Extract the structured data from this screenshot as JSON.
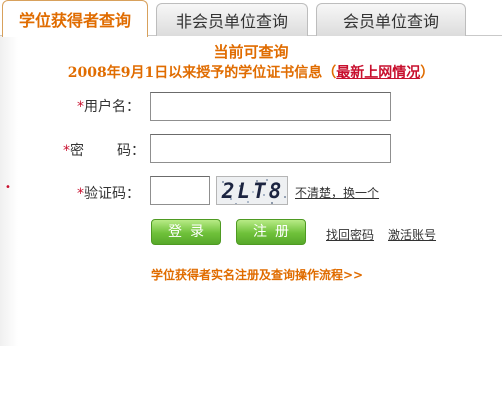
{
  "tabs": [
    {
      "label": "学位获得者查询",
      "active": true
    },
    {
      "label": "非会员单位查询",
      "active": false
    },
    {
      "label": "会员单位查询",
      "active": false
    }
  ],
  "heading": {
    "title": "当前可查询",
    "subtitle": "2008年9月1日以来授予的学位证书信息",
    "paren_open": "（",
    "latest_link": "最新上网情况",
    "paren_close": "）"
  },
  "form": {
    "required_mark": "*",
    "username_label": "用户名：",
    "password_label_a": "密",
    "password_label_b": "码：",
    "captcha_label": "验证码：",
    "username_value": "",
    "password_value": "",
    "captcha_value": "",
    "captcha_text": "2LT8",
    "refresh_link": "不清楚，换一个"
  },
  "buttons": {
    "login": "登录",
    "register": "注册"
  },
  "links": {
    "recover_password": "找回密码",
    "activate_account": "激活账号",
    "flow": "学位获得者实名注册及查询操作流程>>"
  },
  "colors": {
    "accent": "#e06c00",
    "required": "#c8102e",
    "button_green": "#6fc13a"
  }
}
